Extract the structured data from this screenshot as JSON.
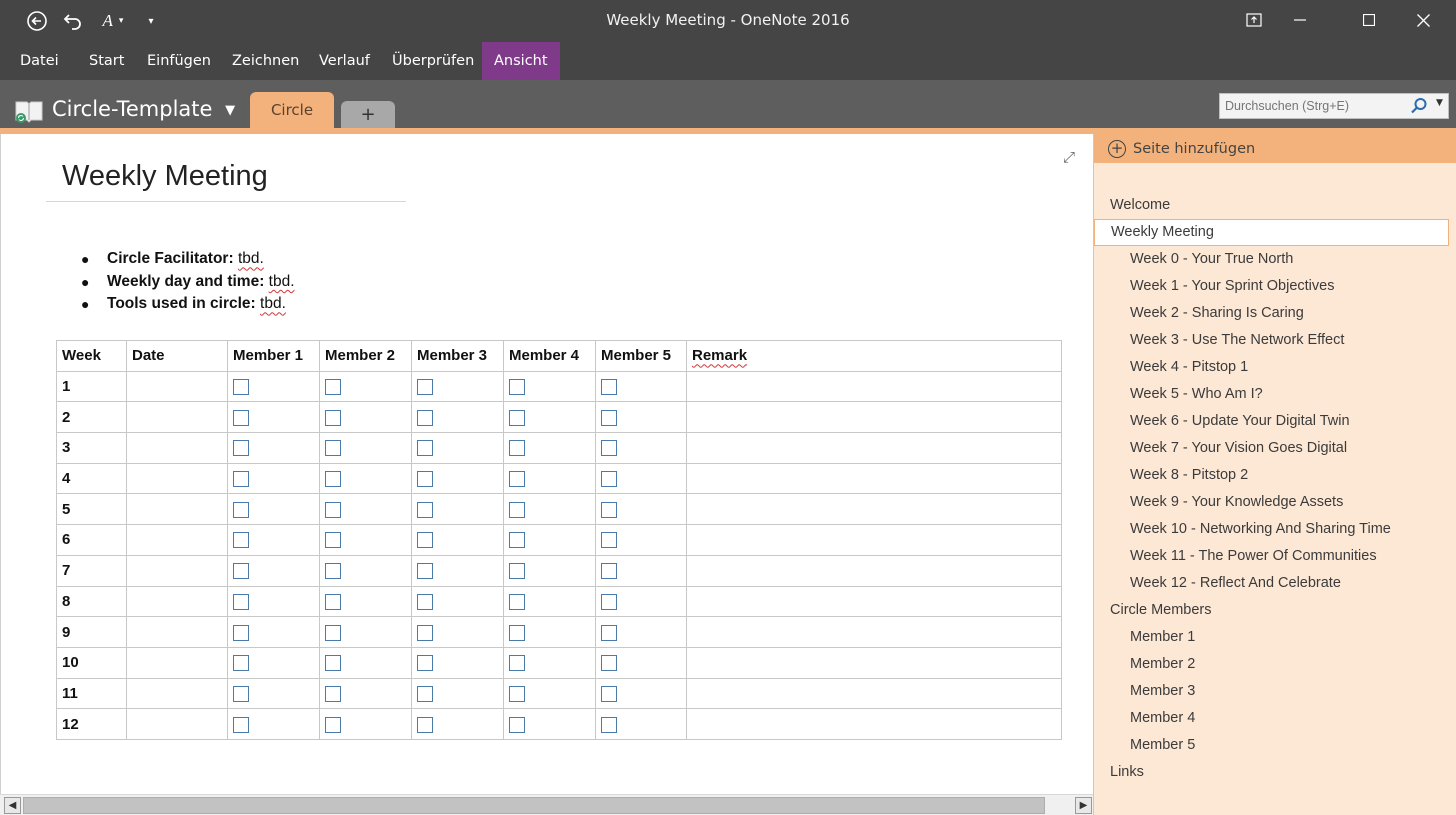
{
  "window": {
    "title": "Weekly Meeting  -  OneNote 2016"
  },
  "ribbon": {
    "tabs": [
      "Datei",
      "Start",
      "Einfügen",
      "Zeichnen",
      "Verlauf",
      "Überprüfen",
      "Ansicht"
    ],
    "active_tab": "Ansicht"
  },
  "notebook": {
    "name": "Circle-Template",
    "section": "Circle",
    "add_section_label": "+"
  },
  "search": {
    "placeholder": "Durchsuchen (Strg+E)"
  },
  "page": {
    "title": "Weekly Meeting",
    "bullets": [
      {
        "label": "Circle Facilitator:",
        "value": "tbd."
      },
      {
        "label": "Weekly day and time:",
        "value": "tbd."
      },
      {
        "label": "Tools used in circle:",
        "value": "tbd."
      }
    ],
    "table": {
      "headers": [
        "Week",
        "Date",
        "Member 1",
        "Member 2",
        "Member 3",
        "Member 4",
        "Member 5",
        "Remark"
      ],
      "weeks": [
        "1",
        "2",
        "3",
        "4",
        "5",
        "6",
        "7",
        "8",
        "9",
        "10",
        "11",
        "12"
      ]
    }
  },
  "page_pane": {
    "add_page_label": "Seite hinzufügen",
    "pages": [
      {
        "label": "Welcome",
        "level": 1
      },
      {
        "label": "Weekly Meeting",
        "level": 1,
        "selected": true
      },
      {
        "label": "Week 0 - Your True North",
        "level": 2
      },
      {
        "label": "Week 1 - Your Sprint Objectives",
        "level": 2
      },
      {
        "label": "Week 2 - Sharing Is Caring",
        "level": 2
      },
      {
        "label": "Week 3 - Use The Network Effect",
        "level": 2
      },
      {
        "label": "Week 4 - Pitstop 1",
        "level": 2
      },
      {
        "label": "Week 5 - Who Am I?",
        "level": 2
      },
      {
        "label": "Week 6 - Update Your Digital Twin",
        "level": 2
      },
      {
        "label": "Week 7 - Your Vision Goes Digital",
        "level": 2
      },
      {
        "label": "Week 8 - Pitstop 2",
        "level": 2
      },
      {
        "label": "Week 9 - Your Knowledge Assets",
        "level": 2
      },
      {
        "label": "Week 10 - Networking And Sharing Time",
        "level": 2
      },
      {
        "label": "Week 11 - The Power Of Communities",
        "level": 2
      },
      {
        "label": "Week 12 - Reflect And Celebrate",
        "level": 2
      },
      {
        "label": "Circle Members",
        "level": 1
      },
      {
        "label": "Member 1",
        "level": 2
      },
      {
        "label": "Member 2",
        "level": 2
      },
      {
        "label": "Member 3",
        "level": 2
      },
      {
        "label": "Member 4",
        "level": 2
      },
      {
        "label": "Member 5",
        "level": 2
      },
      {
        "label": "Links",
        "level": 1
      }
    ]
  },
  "colors": {
    "ribbon_bg": "#454545",
    "active_tab": "#7f3b8a",
    "section_orange": "#f3b27b",
    "page_pane_bg": "#fde8d6"
  },
  "icons": [
    "back-icon",
    "undo-icon",
    "format-painter-icon",
    "customize-icon",
    "restore-icon",
    "minimize-icon",
    "maximize-icon",
    "close-icon",
    "notebook-icon",
    "search-icon",
    "expand-icon",
    "add-page-icon"
  ]
}
